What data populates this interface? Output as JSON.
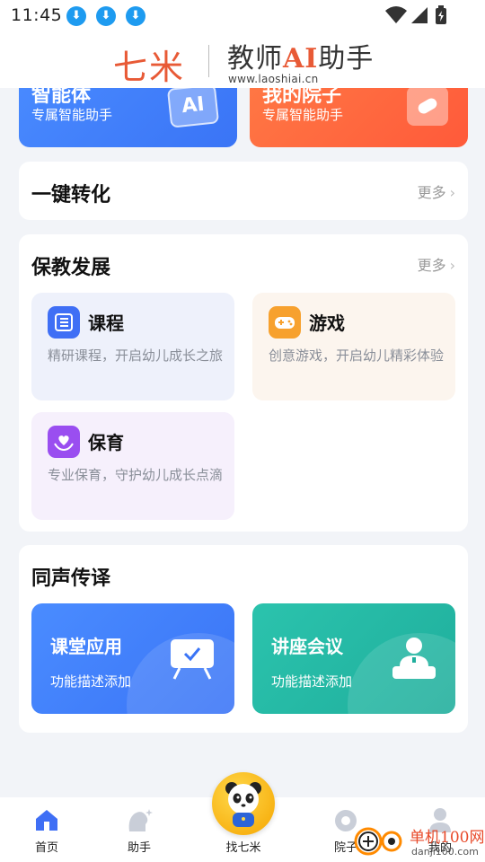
{
  "status_bar": {
    "time": "11:45"
  },
  "brand": {
    "name_cn": "七米",
    "title_pre": "教师",
    "title_ai": "AI",
    "title_post": "助手",
    "url": "www.laoshiai.cn"
  },
  "feature_cards": [
    {
      "title": "智能体",
      "subtitle": "专属智能助手",
      "icon_text": "AI"
    },
    {
      "title": "我的院子",
      "subtitle": "专属智能助手"
    }
  ],
  "quick_convert": {
    "title": "一键转化",
    "more": "更多"
  },
  "development": {
    "title": "保教发展",
    "more": "更多",
    "tiles": [
      {
        "title": "课程",
        "desc": "精研课程，开启幼儿成长之旅"
      },
      {
        "title": "游戏",
        "desc": "创意游戏，开启幼儿精彩体验"
      },
      {
        "title": "保育",
        "desc": "专业保育，守护幼儿成长点滴"
      }
    ]
  },
  "interpretation": {
    "title": "同声传译",
    "cards": [
      {
        "title": "课堂应用",
        "desc": "功能描述添加"
      },
      {
        "title": "讲座会议",
        "desc": "功能描述添加"
      }
    ]
  },
  "nav": {
    "items": [
      {
        "label": "首页",
        "icon": "home-icon"
      },
      {
        "label": "助手",
        "icon": "assistant-icon"
      },
      {
        "label": "找七米",
        "icon": "panda-icon"
      },
      {
        "label": "院子",
        "icon": "yard-icon"
      },
      {
        "label": "我的",
        "icon": "profile-icon"
      }
    ]
  },
  "watermark": {
    "text": "单机100网",
    "url": "danji100.com"
  },
  "colors": {
    "blue": "#3a74f6",
    "orange": "#ff5a3a",
    "teal": "#22b8a6",
    "brand_red": "#e85a36"
  }
}
